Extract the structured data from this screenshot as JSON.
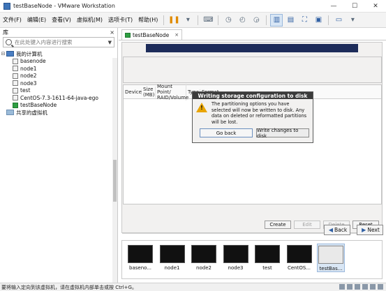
{
  "window": {
    "title": "testBaseNode - VMware Workstation",
    "minimize": "—",
    "maximize": "☐",
    "close": "✕"
  },
  "menu": [
    "文件(F)",
    "编辑(E)",
    "查看(V)",
    "虚拟机(M)",
    "选项卡(T)",
    "帮助(H)"
  ],
  "library": {
    "title": "库",
    "close": "×",
    "search_placeholder": "在此处键入内容进行搜索",
    "root": "我的计算机",
    "vms": [
      "basenode",
      "node1",
      "node2",
      "node3",
      "test",
      "CentOS-7.3-1611-64-java-ego",
      "testBaseNode"
    ],
    "shared": "共享的虚拟机"
  },
  "tab": {
    "label": "testBaseNode",
    "close": "×"
  },
  "installer": {
    "columns": [
      "Device",
      "Size (MB)",
      "Mount Point/ RAID/Volume",
      "Type",
      "Format"
    ],
    "dialog": {
      "title": "Writing storage configuration to disk",
      "message": "The partitioning options you have selected will now be written to disk.  Any data on deleted or reformatted partitions will be lost.",
      "go_back": "Go back",
      "write": "Write changes to disk"
    },
    "buttons": {
      "create": "Create",
      "edit": "Edit",
      "delete": "Delete",
      "reset": "Reset"
    },
    "back": "Back",
    "next": "Next"
  },
  "thumbnails": [
    "baseno...",
    "node1",
    "node2",
    "node3",
    "test",
    "CentOS...",
    "testBas..."
  ],
  "status": "要将输入定向到该虚拟机，请在虚拟机内部单击或按 Ctrl+G。"
}
